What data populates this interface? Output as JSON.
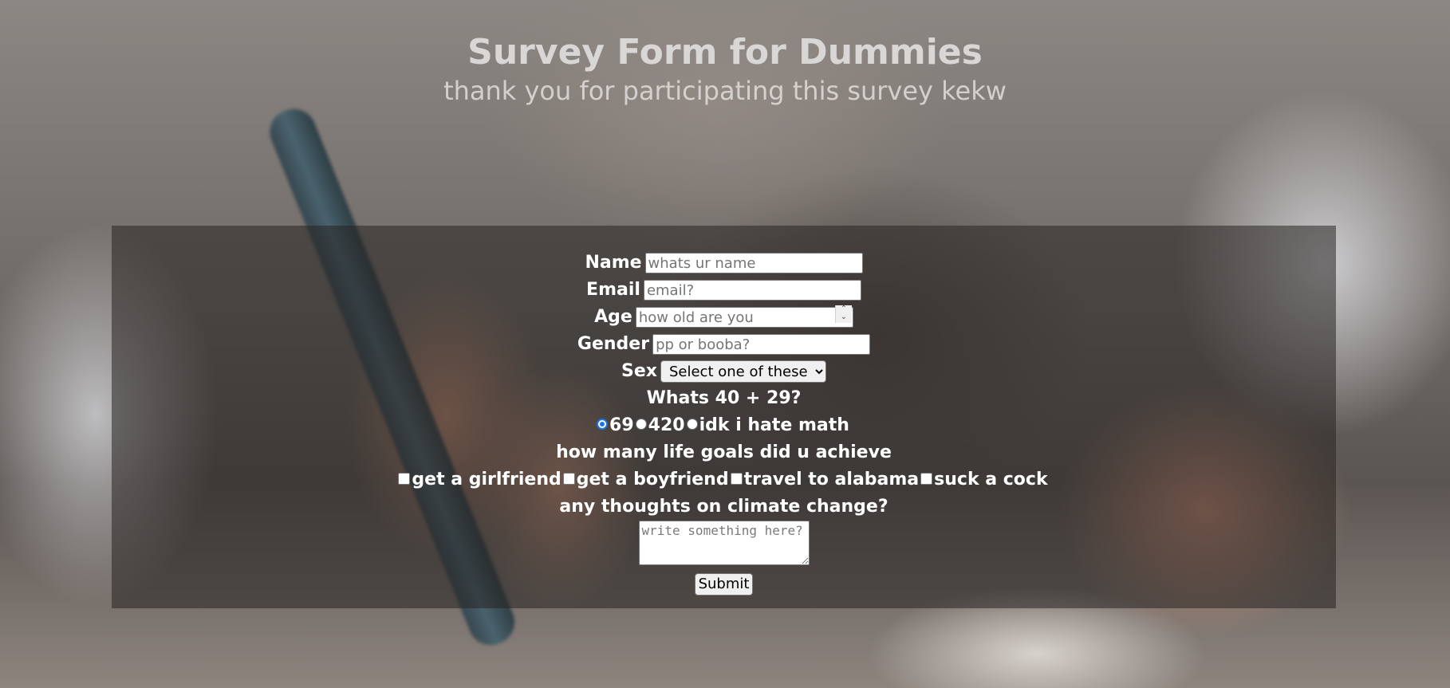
{
  "header": {
    "title": "Survey Form for Dummies",
    "subtitle": "thank you for participating this survey kekw"
  },
  "form": {
    "name": {
      "label": "Name",
      "placeholder": "whats ur name",
      "value": ""
    },
    "email": {
      "label": "Email",
      "placeholder": "email?",
      "value": ""
    },
    "age": {
      "label": "Age",
      "placeholder": "how old are you",
      "value": ""
    },
    "gender": {
      "label": "Gender",
      "placeholder": "pp or booba?",
      "value": ""
    },
    "sex": {
      "label": "Sex",
      "selected": "Select one of these"
    },
    "math": {
      "question": "Whats 40 + 29?",
      "options": [
        "69",
        "420",
        "idk i hate math"
      ],
      "selected_index": 0
    },
    "goals": {
      "question": "how many life goals did u achieve",
      "options": [
        "get a girlfriend",
        "get a boyfriend",
        "travel to alabama",
        "suck a cock"
      ]
    },
    "climate": {
      "question": "any thoughts on climate change?",
      "placeholder": "write something here?"
    },
    "submit_label": "Submit"
  },
  "colors": {
    "panel": "#28242299",
    "text": "#ffffff",
    "radio_accent": "#1a73e8"
  }
}
